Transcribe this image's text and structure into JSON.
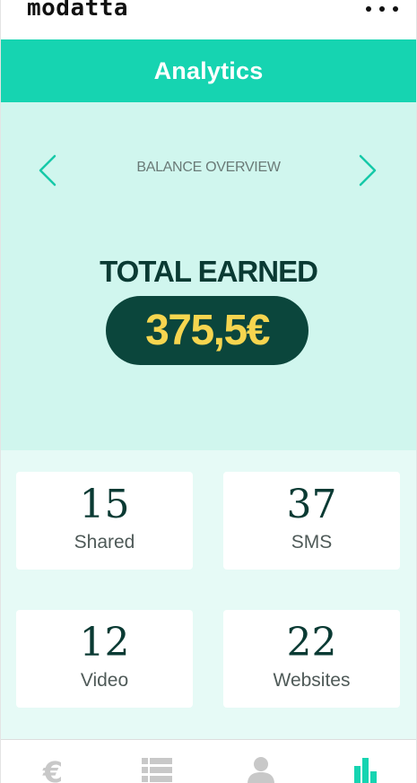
{
  "app": {
    "logo": "modatta"
  },
  "header": {
    "title": "Analytics"
  },
  "balance": {
    "label": "BALANCE OVERVIEW",
    "total_title": "TOTAL EARNED",
    "amount": "375,5€"
  },
  "stats": [
    {
      "value": "15",
      "label": "Shared"
    },
    {
      "value": "37",
      "label": "SMS"
    },
    {
      "value": "12",
      "label": "Video"
    },
    {
      "value": "22",
      "label": "Websites"
    }
  ],
  "bottom_nav": {
    "tabs": [
      {
        "icon": "euro-icon",
        "active": false
      },
      {
        "icon": "list-icon",
        "active": false
      },
      {
        "icon": "user-icon",
        "active": false
      },
      {
        "icon": "bar-chart-icon",
        "active": true
      }
    ]
  },
  "colors": {
    "accent": "#16d4b1",
    "balance_bg": "#d0f6ee",
    "stats_bg": "#e6faf6",
    "dark_green": "#0b463c",
    "amount_yellow": "#f6d54f",
    "inactive_icon": "#c8c8c8"
  }
}
